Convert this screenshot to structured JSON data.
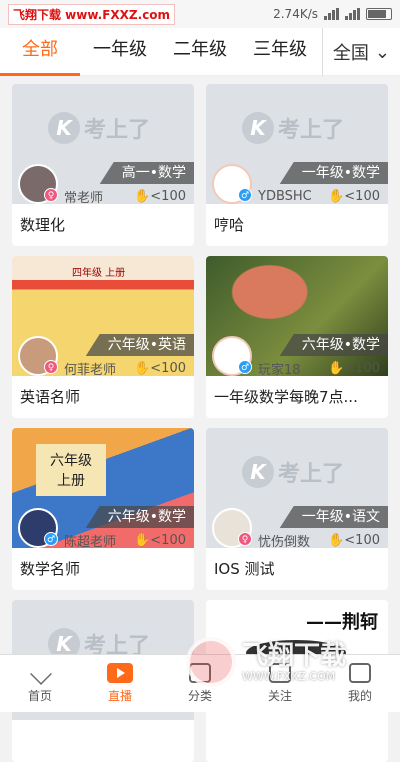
{
  "statusbar": {
    "watermark": "飞翔下载 www.FXXZ.com",
    "speed": "2.74K/s"
  },
  "tabs": [
    "全部",
    "一年级",
    "二年级",
    "三年级"
  ],
  "region": {
    "label": "全国"
  },
  "logo_text": "考上了",
  "cards": [
    {
      "tag": "高一•数学",
      "name": "常老师",
      "views": "<100",
      "title": "数理化",
      "gender": "f",
      "thumb": "gray"
    },
    {
      "tag": "一年级•数学",
      "name": "YDBSHC",
      "views": "<100",
      "title": "哼哈",
      "gender": "m",
      "thumb": "gray"
    },
    {
      "tag": "六年级•英语",
      "name": "何菲老师",
      "views": "<100",
      "title": "英语名师",
      "gender": "f",
      "thumb": "book",
      "book_title": "四年级  上册"
    },
    {
      "tag": "六年级•数学",
      "name": "玩家18",
      "views": "<100",
      "title": "一年级数学每晚7点...",
      "gender": "m",
      "thumb": "mush"
    },
    {
      "tag": "六年级•数学",
      "name": "陈超老师",
      "views": "<100",
      "title": "数学名师",
      "gender": "m",
      "thumb": "six",
      "overlay": "六年级\n上册"
    },
    {
      "tag": "一年级•语文",
      "name": "忧伤倒数",
      "views": "<100",
      "title": "IOS 测试",
      "gender": "f",
      "thumb": "gray"
    },
    {
      "thumb": "gray"
    },
    {
      "thumb": "text",
      "overlay": "——荆轲"
    }
  ],
  "bottomnav": [
    "首页",
    "直播",
    "分类",
    "关注",
    "我的"
  ],
  "watermark": {
    "brand": "飞翔下载",
    "url": "WWW.FXXZ.COM"
  },
  "colors": {
    "accent": "#ff6a1a"
  }
}
